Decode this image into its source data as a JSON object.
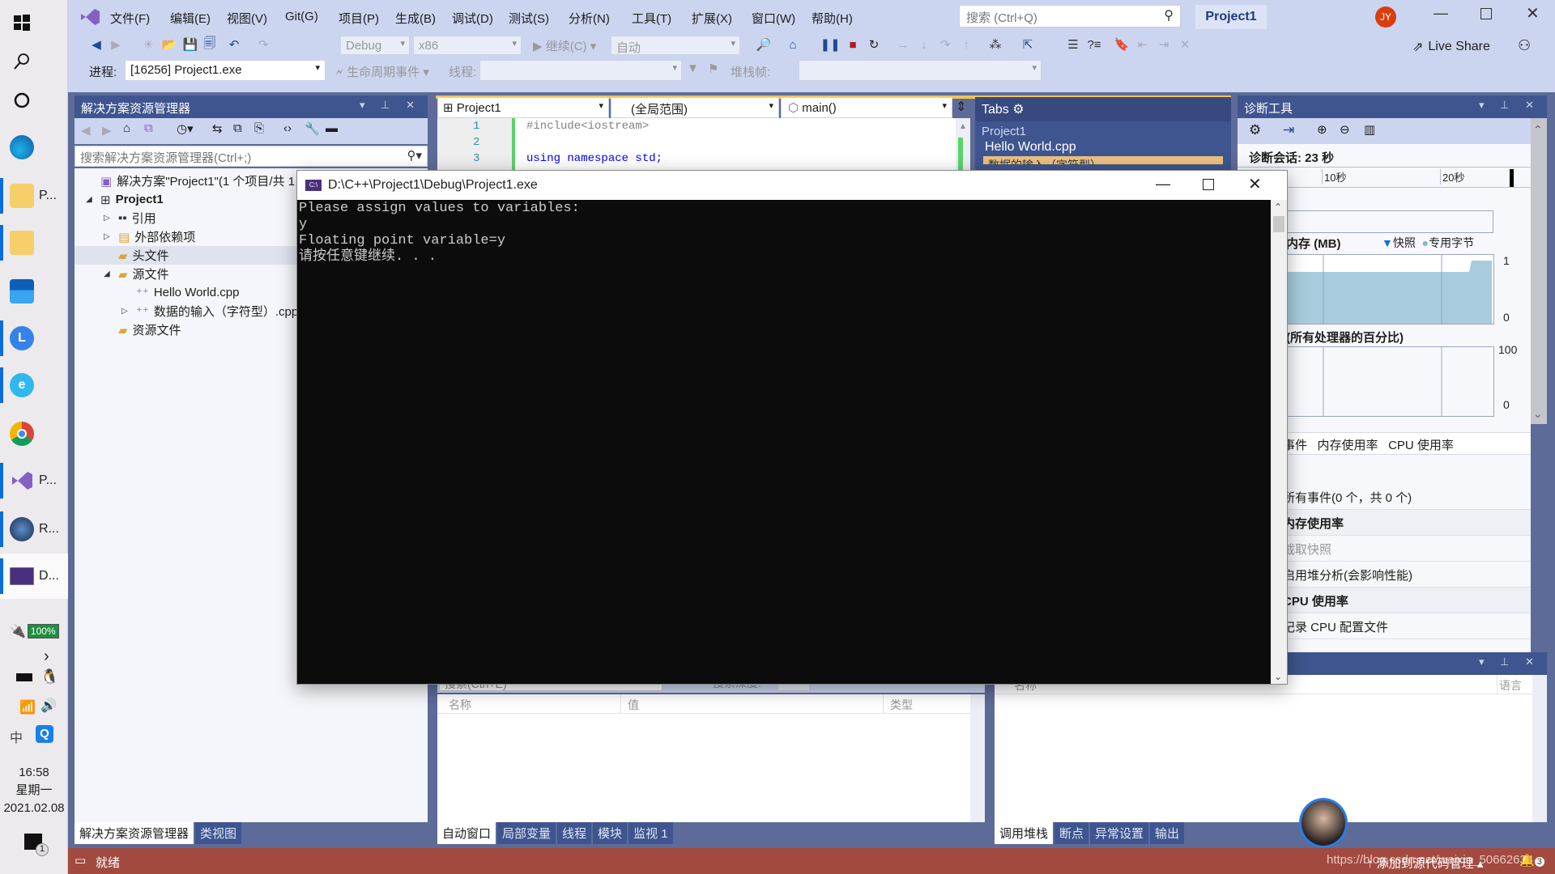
{
  "taskbar": {
    "items": [
      {
        "icon": "windows-start-icon",
        "label": ""
      },
      {
        "icon": "search-icon",
        "label": ""
      },
      {
        "icon": "cortana-icon",
        "label": ""
      },
      {
        "icon": "edge-icon",
        "label": ""
      },
      {
        "icon": "folder-icon",
        "label": "P..."
      },
      {
        "icon": "folder-icon",
        "label": ""
      },
      {
        "icon": "mail-icon",
        "label": ""
      },
      {
        "icon": "clock-app-icon",
        "label": ""
      },
      {
        "icon": "browser-e-icon",
        "label": ""
      },
      {
        "icon": "chrome-icon",
        "label": ""
      },
      {
        "icon": "visual-studio-icon",
        "label": "P..."
      },
      {
        "icon": "avatar-app-icon",
        "label": "R..."
      },
      {
        "icon": "console-icon",
        "label": "D..."
      }
    ],
    "battery": "100%",
    "time": "16:58",
    "weekday": "星期一",
    "date": "2021.02.08",
    "ime": "中",
    "notification_count": "1"
  },
  "menubar": {
    "items": [
      "文件(F)",
      "编辑(E)",
      "视图(V)",
      "Git(G)",
      "项目(P)",
      "生成(B)",
      "调试(D)",
      "测试(S)",
      "分析(N)",
      "工具(T)",
      "扩展(X)",
      "窗口(W)",
      "帮助(H)"
    ],
    "search_placeholder": "搜索 (Ctrl+Q)",
    "project_title": "Project1",
    "user_initials": "JY",
    "live_share": "Live Share"
  },
  "toolbar": {
    "config": "Debug",
    "platform": "x86",
    "continue_label": "继续(C)",
    "auto_label": "自动",
    "process_label": "进程:",
    "process_value": "[16256] Project1.exe",
    "lifecycle_label": "生命周期事件",
    "thread_label": "线程:",
    "stackframe_label": "堆栈帧:"
  },
  "solution_explorer": {
    "title": "解决方案资源管理器",
    "search_placeholder": "搜索解决方案资源管理器(Ctrl+;)",
    "tree": [
      {
        "label": "解决方案\"Project1\"(1 个项目/共 1",
        "level": 0,
        "icon": "solution-icon"
      },
      {
        "label": "Project1",
        "level": 0,
        "icon": "project-icon",
        "bold": true,
        "expanded": true
      },
      {
        "label": "引用",
        "level": 1,
        "icon": "references-icon",
        "collapsed": true
      },
      {
        "label": "外部依赖项",
        "level": 1,
        "icon": "external-deps-icon",
        "collapsed": true
      },
      {
        "label": "头文件",
        "level": 1,
        "icon": "folder-icon"
      },
      {
        "label": "源文件",
        "level": 1,
        "icon": "folder-icon",
        "expanded": true,
        "selected": true
      },
      {
        "label": "Hello World.cpp",
        "level": 2,
        "icon": "cpp-file-icon"
      },
      {
        "label": "数据的输入（字符型）.cpp",
        "level": 2,
        "icon": "cpp-file-icon",
        "collapsed": true
      },
      {
        "label": "资源文件",
        "level": 1,
        "icon": "folder-icon"
      }
    ],
    "bottom_tabs": [
      "解决方案资源管理器",
      "类视图"
    ]
  },
  "editor": {
    "nav_project": "Project1",
    "nav_scope": "(全局范围)",
    "nav_member": "main()",
    "lines": [
      {
        "num": "1",
        "code": "#include<iostream>"
      },
      {
        "num": "2",
        "code": ""
      },
      {
        "num": "3",
        "code": "using namespace std;"
      }
    ]
  },
  "tabs_panel": {
    "title": "Tabs",
    "group": "Project1",
    "items": [
      "Hello World.cpp",
      "数据的输入（字符型）"
    ]
  },
  "diagnostics": {
    "title": "诊断工具",
    "session": "诊断会话: 23 秒",
    "ticks": [
      "10秒",
      "20秒"
    ],
    "memory_title": "内存 (MB)",
    "legend_snapshot": "快照",
    "legend_private": "专用字节",
    "memory_max": "1",
    "memory_min": "0",
    "cpu_title": "(所有处理器的百分比)",
    "cpu_max": "100",
    "cpu_min": "0",
    "subtabs": [
      "事件",
      "内存使用率",
      "CPU 使用率"
    ],
    "rows": [
      {
        "text": "所有事件(0 个，共 0 个)",
        "bold": false
      },
      {
        "text": "内存使用率",
        "bold": true
      },
      {
        "text": "截取快照",
        "bold": false,
        "disabled": true
      },
      {
        "text": "启用堆分析(会影响性能)",
        "bold": false
      },
      {
        "text": "CPU 使用率",
        "bold": true
      },
      {
        "text": "记录 CPU 配置文件",
        "bold": false
      }
    ]
  },
  "autos": {
    "search_placeholder": "搜索(Ctrl+E)",
    "depth_label": "搜索深度:",
    "columns": [
      "名称",
      "值",
      "类型"
    ],
    "bottom_tabs": [
      "自动窗口",
      "局部变量",
      "线程",
      "模块",
      "监视 1"
    ]
  },
  "callstack": {
    "columns": [
      "名称",
      "语言"
    ],
    "bottom_tabs": [
      "调用堆栈",
      "断点",
      "异常设置",
      "输出"
    ]
  },
  "console": {
    "title": "D:\\C++\\Project1\\Debug\\Project1.exe",
    "lines": [
      "Please assign values to variables:",
      "y",
      "Floating point variable=y",
      "请按任意键继续. . ."
    ]
  },
  "statusbar": {
    "ready": "就绪",
    "source_control": "添加到源代码管理",
    "watermark": "https://blog.csdn.net/weixin_50662634",
    "notifications": "3"
  },
  "colors": {
    "accent": "#3f558f",
    "statusbar": "#a24a3f",
    "chrome": "#ccd5f0",
    "memory_fill": "#9ec4d6"
  }
}
